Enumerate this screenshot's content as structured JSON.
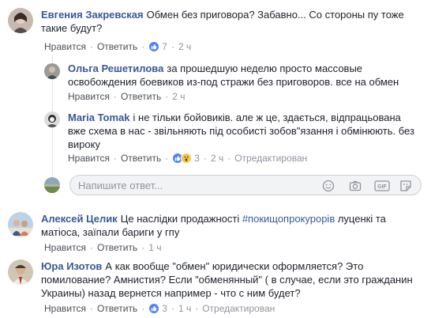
{
  "actions": {
    "like": "Нравится",
    "reply": "Ответить"
  },
  "comments": [
    {
      "author": "Евгения Закревская",
      "text": "Обмен без приговора? Забавно... Со стороны пу тоже такие будут?",
      "reactions": "7",
      "time": "2 ч"
    },
    {
      "author": "Алексей Целик",
      "text_before": "Це наслідки продажності ",
      "hashtag": "#покищопрокурорів",
      "text_after": " луценкі та матіоса, заїпали бариги у гпу",
      "time": "1 ч"
    },
    {
      "author": "Юра Изотов",
      "text": "А как вообще \"обмен\" юридически оформляется? Это помилование? Амнистия? Если \"обменянный\" ( в случае, если это гражданин Украины) назад вернется например - что с ним будет?",
      "reactions": "3",
      "time": "1 ч",
      "edited": "Отредактирован"
    }
  ],
  "replies": [
    {
      "author": "Ольга Решетилова",
      "text": "за прошедшую неделю просто массовые освобождения боевиков из-под стражи без приговоров. все на обмен",
      "time": "2 ч"
    },
    {
      "author": "Maria Tomak",
      "text": "і не тільки бойовиків. але ж це, здається, відпрацьована вже схема в нас - звільняють під особисті зобов\"язання і обмінюють. без вироку",
      "reactions": "3",
      "time": "2 ч",
      "edited": "Отредактирован"
    }
  ],
  "reply_input": {
    "placeholder": "Напишите ответ..."
  },
  "icons": [
    "emoji-icon",
    "camera-icon",
    "gif-icon",
    "sticker-icon"
  ],
  "colors": {
    "link": "#385898",
    "like_blue": "#4f83f0",
    "wow_yellow": "#f7c949",
    "input_bg": "#f2f3f5"
  }
}
